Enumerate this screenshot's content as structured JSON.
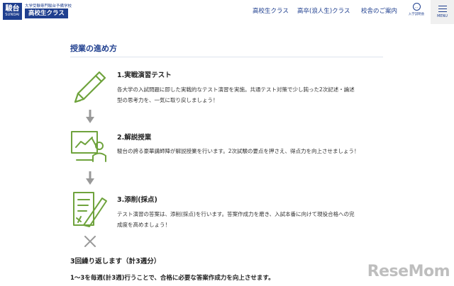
{
  "header": {
    "logo": {
      "kanji": "駿台",
      "roman": "SUNDAI"
    },
    "brand_sub": "大学受験専門駿台予備学校",
    "brand_badge": "高校生クラス",
    "nav": [
      "高校生クラス",
      "高卒(浪人生)クラス",
      "校舎のご案内"
    ],
    "guide_label": "入学説明会",
    "menu_label": "MENU"
  },
  "section_title": "授業の進め方",
  "steps": [
    {
      "title": "1.実戦演習テスト",
      "desc_lines": [
        "各大学の入試問題に即した実戦的なテスト演習を実施。共通テスト対策で少し鈍った2次記述・論述",
        "型の思考力を、一気に取り戻しましょう！"
      ],
      "icon": "pencil-icon"
    },
    {
      "title": "2.解説授業",
      "desc_lines": [
        "駿台の誇る豪華講師陣が解説授業を行います。2次試験の要点を押さえ、得点力を向上させましょう！"
      ],
      "icon": "lecture-icon"
    },
    {
      "title": "3.添削(採点)",
      "desc_lines": [
        "テスト演習の答案は、添削(採点)を行います。答案作成力を磨き、入試本番に向けて現役合格への完",
        "成度を高めましょう！"
      ],
      "icon": "document-pen-icon"
    }
  ],
  "repeat_text": "3回繰り返します（計3週分）",
  "summary_text": "1～3を毎週(計3週)行うことで、合格に必要な答案作成力を向上させます。",
  "watermark": "ReseMom",
  "colors": {
    "brand": "#1f3f8f",
    "icon_green": "#6fa33d",
    "arrow_gray": "#999999"
  }
}
